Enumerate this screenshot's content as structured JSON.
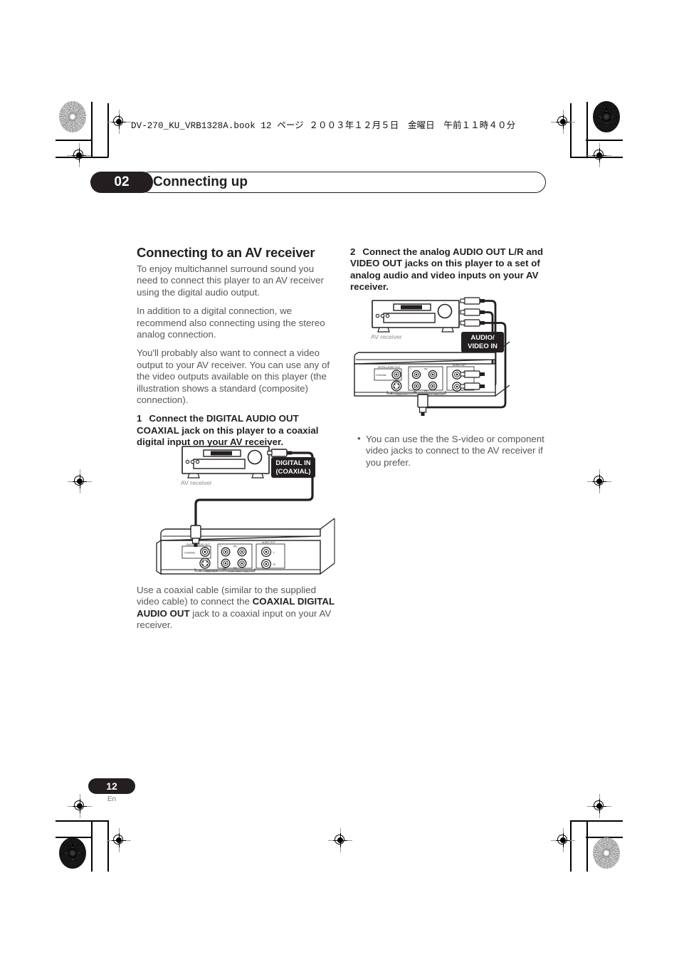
{
  "header": {
    "file_line": "DV-270_KU_VRB1328A.book  12 ページ  ２００３年１２月５日　金曜日　午前１１時４０分"
  },
  "chapter": {
    "number": "02",
    "title": "Connecting up"
  },
  "left_column": {
    "section_title": "Connecting to an AV receiver",
    "para1": "To enjoy multichannel surround sound you need to connect this player to an AV receiver using the digital audio output.",
    "para2": "In addition to a digital connection, we recommend also connecting using the stereo analog connection.",
    "para3": "You'll probably also want to connect a video output to your AV receiver. You can use any of the video outputs available on this player (the illustration shows a standard (composite) connection).",
    "step1_num": "1",
    "step1_text": "Connect the DIGITAL AUDIO OUT COAXIAL jack on this player to a coaxial digital input on your AV receiver.",
    "caption_part1": "Use a coaxial cable (similar to the supplied video cable) to connect the ",
    "caption_bold": "COAXIAL DIGITAL AUDIO OUT",
    "caption_part2": " jack to a coaxial input on your AV receiver."
  },
  "right_column": {
    "step2_num": "2",
    "step2_text": "Connect the analog AUDIO OUT L/R and VIDEO OUT jacks on this player to a set of analog audio and video inputs on your AV receiver.",
    "bullet1": "You can use the the S-video or component video jacks to connect to the AV receiver if you prefer."
  },
  "figure1": {
    "device_label": "AV receiver",
    "badge": "DIGITAL IN\n(COAXIAL)",
    "badge_line1": "DIGITAL IN",
    "badge_line2": "(COAXIAL)",
    "panel_labels": {
      "digital_out": "DIGITAL AUDIO OUT",
      "coaxial": "COAXIAL",
      "audio_out": "AUDIO OUT",
      "left": "L",
      "right": "R",
      "y": "Y",
      "pb": "PB",
      "pr": "PR",
      "s": "S",
      "s_video_out": "VIDEO OUT",
      "component_video_out": "COMPONENT VIDEO OUT"
    }
  },
  "figure2": {
    "device_label": "AV receiver",
    "badge_line1": "AUDIO/",
    "badge_line2": "VIDEO IN",
    "panel_labels": {
      "digital_out": "DIGITAL AUDIO OUT",
      "coaxial": "COAXIAL",
      "audio_out": "AUDIO OUT",
      "left": "L",
      "right": "R",
      "y": "Y",
      "pb": "PB",
      "pr": "PR",
      "s": "S",
      "s_video_out": "VIDEO OUT",
      "component_video_out": "COMPONENT VIDEO OUT"
    }
  },
  "footer": {
    "page_number": "12",
    "language": "En"
  },
  "colors": {
    "ink": "#231f20",
    "body_text": "#575757",
    "muted": "#8d8d8d"
  }
}
